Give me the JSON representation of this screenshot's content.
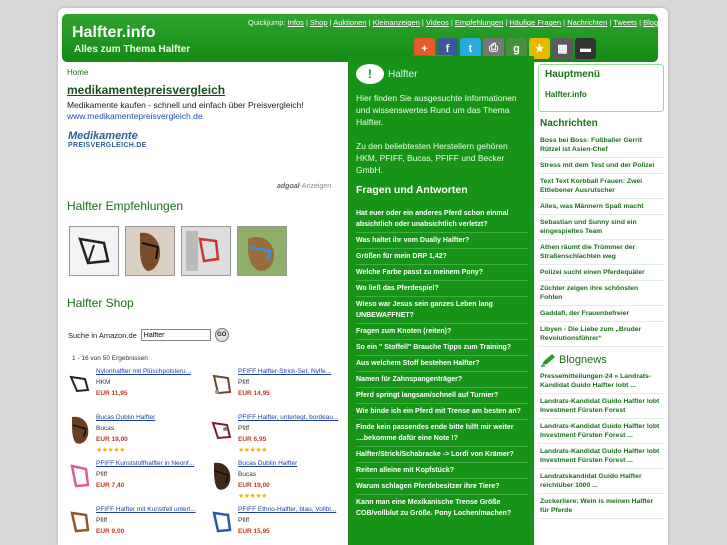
{
  "header": {
    "title": "Halfter.info",
    "subtitle": "Alles zum Thema Halfter",
    "quickjump_label": "Quickjump:",
    "quickjump_links": [
      "Infos",
      "Shop",
      "Auktionen",
      "Kleinanzeigen",
      "Videos",
      "Empfehlungen",
      "Häufige Fragen",
      "Nachrichten",
      "Tweets",
      "Blognews"
    ]
  },
  "share_icons": [
    "plus-icon",
    "facebook-icon",
    "twitter-icon",
    "print-icon",
    "google-icon",
    "favorite-icon",
    "delicious-icon",
    "digg-icon",
    "stumbleupon-icon",
    "myspace-icon"
  ],
  "left": {
    "breadcrumb": "Home",
    "ad": {
      "title": "medikamentepreisvergleich",
      "text": "Medikamente kaufen - schnell und einfach über Preisvergleich!",
      "url": "www.medikamentepreisvergleich.de",
      "logo_line1": "Medikamente",
      "logo_line2": "PREISVERGLEICH.DE",
      "adgoal": "adgoal",
      "adgoal_suffix": "-Anzeigen"
    },
    "recommendations_head": "Halfter Empfehlungen",
    "shop_head": "Halfter Shop",
    "search_label": "Suche in Amazon.de",
    "search_value": "Halfter",
    "go_label": "GO",
    "results": "1 - 16 von 50 Ergebnissen",
    "products": [
      {
        "name": "Nylonhalfter mit Plüschpolsteru...",
        "brand": "HKM",
        "price": "EUR 11,95",
        "stars": ""
      },
      {
        "name": "PFIFF Halfter-Strick-Set, Nylfe...",
        "brand": "Pfiff",
        "price": "EUR 14,95",
        "stars": ""
      },
      {
        "name": "Bucas Dublin Halfter",
        "brand": "Bucas",
        "price": "EUR 19,00",
        "stars": "★★★★★"
      },
      {
        "name": "PFIFF Halfter, unterlegt, bordeau...",
        "brand": "Pfiff",
        "price": "EUR 6,95",
        "stars": "★★★★★"
      },
      {
        "name": "PFIFF Kunststoffhalfter in Neonf...",
        "brand": "Pfiff",
        "price": "EUR 7,40",
        "stars": ""
      },
      {
        "name": "Bucas Dublin Halfter",
        "brand": "Bucas",
        "price": "EUR 19,00",
        "stars": "★★★★★"
      },
      {
        "name": "PFIFF Halfter mit Kunstfell unterl...",
        "brand": "Pfiff",
        "price": "EUR 9,00",
        "stars": ""
      },
      {
        "name": "PFIFF Ethno-Halfter, blau, Vollbl...",
        "brand": "Pfiff",
        "price": "EUR 15,95",
        "stars": ""
      }
    ]
  },
  "middle": {
    "intro_head": "Halfter",
    "intro": "Hier finden Sie ausgesuchte Informationen und wissenswertes Rund um das Thema Halfter.\n\nZu den beliebtesten Herstellern gehören HKM, PFIFF, Bucas, PFIFF und Becker GmbH.",
    "qa_head": "Fragen und Antworten",
    "qa": [
      "Hat euer oder ein anderes Pferd schon einmal absichtlich oder unabsichtlich verletzt?",
      "Was haltet ihr vom Dually Halfter?",
      "Größen für mein DRP 1,42?",
      "Welche Farbe passt zu meinem Pony?",
      "Wo ließ das Pferdespiel?",
      "Wieso war Jesus sein ganzes Leben lang UNBEWAFFNET?",
      "Fragen zum Knoten (reiten)?",
      "So ein \" Stoffell\" Brauche Tipps zum Training?",
      "Aus welchem Stoff bestehen Halfter?",
      "Namen für Zahnspangenträger?",
      "Pferd springt langsam/schnell auf Turnier?",
      "Wie binde ich ein Pferd mit Trense am besten an?",
      "Finde kein passendes ende bitte hilft mir weiter ....bekomme dafür eine Note !?",
      "Halfter/Strick/Schabracke -> Lordi von Krämer?",
      "Reiten alleine mit Kopfstück?",
      "Warum schlagen Pferdebesitzer ihre Tiere?",
      "Kann man eine Mexikanische Trense Größe COB/vollblut zu Größe. Pony Lochen/machen?"
    ]
  },
  "right": {
    "hauptmenu_head": "Hauptmenü",
    "hauptmenu_link": "Halfter.info",
    "news_head": "Nachrichten",
    "news": [
      "Boss bei Boss: Fußballer Gerrit Rützel ist Asien-Chef",
      "Stress mit dem Test und der Polizei",
      "Text Text Korbball Frauen: Zwei Ettlebener Ausrutscher",
      "Alles, was Männern Spaß macht",
      "Sebastian und Sunny sind ein eingespieltes Team",
      "Athen räumt die Trümmer der Straßenschlachten weg",
      "Polizei sucht einen Pferdequäler",
      "Züchter zeigen ihre schönsten Fohlen",
      "Gaddafi, der Frauenbefreier",
      "Libyen - Die Liebe zum „Bruder Revolutionsführer“"
    ],
    "blognews_head": "Blognews",
    "blognews": [
      "Pressemitteilungen-24 » Landrats-Kandidat Guido Halfter lobt ...",
      "Landrats-Kandidat Guido Halfter lobt Investment Fürsten Forest",
      "Landrats-Kandidat Guido Halfter lobt Investment Fürsten Forest ...",
      "Landrats-Kandidat Guido Halfter lobt Investment Fürsten Forest ...",
      "Landratskandidat Guido Halfter reichtüber 1000 ...",
      "Zuckerliere: Wein is meinen Halfter für Pferde"
    ]
  }
}
